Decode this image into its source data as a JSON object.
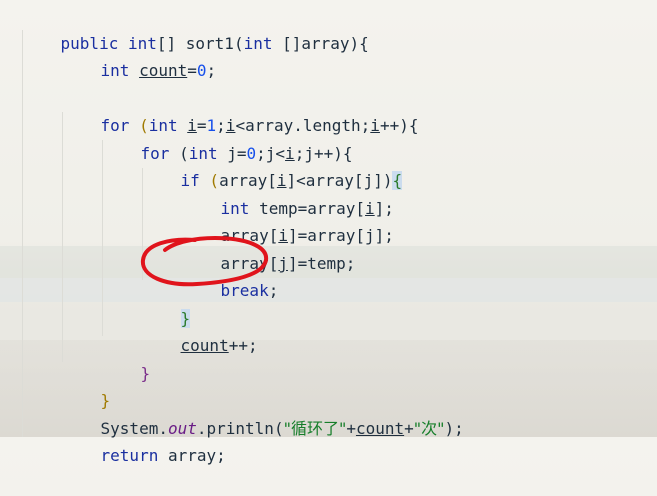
{
  "code": {
    "l1": {
      "a": "public ",
      "b": "int",
      "c": "[] sort1(",
      "d": "int",
      "e": " []array){"
    },
    "l2": {
      "a": "int ",
      "b": "count",
      "c": "=",
      "d": "0",
      "e": ";"
    },
    "l4": {
      "a": "for",
      "b": " (",
      "c": "int ",
      "d": "i",
      "e": "=",
      "f": "1",
      "g": ";",
      "h": "i",
      "i": "<array.length;",
      "j": "i",
      "k": "++){"
    },
    "l5": {
      "a": "for",
      "b": " (",
      "c": "int ",
      "d": "j=",
      "e": "0",
      "f": ";j<",
      "g": "i",
      "h": ";j++){"
    },
    "l6": {
      "a": "if",
      "b": " (",
      "c": "array[",
      "d": "i",
      "e": "]<array[j])",
      "f": "{"
    },
    "l7": {
      "a": "int ",
      "b": "temp=array[",
      "c": "i",
      "d": "];"
    },
    "l8": {
      "a": "array[",
      "b": "i",
      "c": "]=array[j];"
    },
    "l9": {
      "a": "array[",
      "b": "j",
      "c": "]=temp;"
    },
    "l10": {
      "a": "break",
      "b": ";"
    },
    "l11": {
      "a": "}"
    },
    "l12": {
      "a": "count",
      "b": "++;"
    },
    "l13": {
      "a": "}"
    },
    "l14": {
      "a": "}"
    },
    "l15": {
      "a": "System.",
      "b": "out",
      "c": ".println(",
      "d": "\"循环了\"",
      "e": "+",
      "f": "count",
      "g": "+",
      "h": "\"次\"",
      "i": ");"
    },
    "l16": {
      "a": "return ",
      "b": "array;"
    }
  },
  "annotation": {
    "color": "#e0141c",
    "shape": "hand-drawn circle around break statement"
  }
}
